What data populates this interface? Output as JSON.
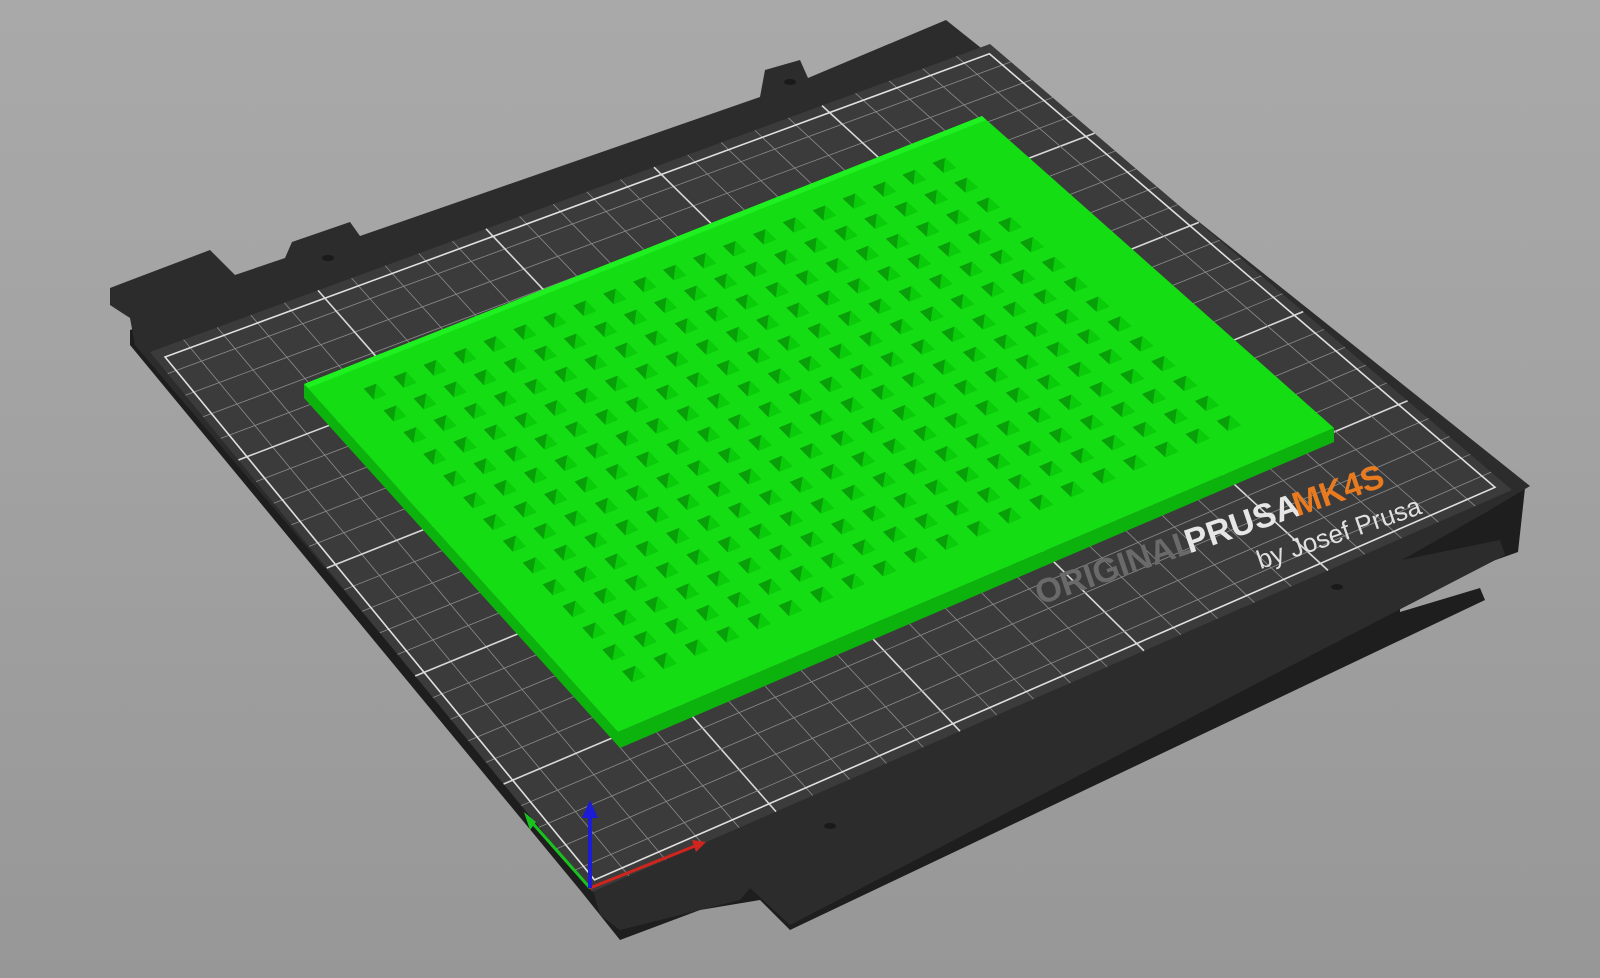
{
  "app": {
    "view": "3D build plate viewport"
  },
  "bed": {
    "brand_prefix": "ORIGINAL",
    "brand_name": "PRUSA",
    "brand_model": "MK4S",
    "brand_byline": "by Josef Prusa"
  },
  "object": {
    "hole_grid": {
      "columns": 20,
      "rows": 14
    }
  },
  "axes": {
    "x_color": "#d0241c",
    "y_color": "#19c21f",
    "z_color": "#1c1cd6"
  },
  "colors": {
    "background": "#a3a3a3",
    "bed_sheet": "#3a3a3a",
    "bed_frame": "#2a2a2a",
    "grid_line": "#9a9a9a",
    "grid_major": "#d8d8d8",
    "object_top": "#14e014",
    "object_side": "#0cb80c",
    "hole_shadow": "#08a308",
    "brand_orange": "#e87a1f"
  }
}
